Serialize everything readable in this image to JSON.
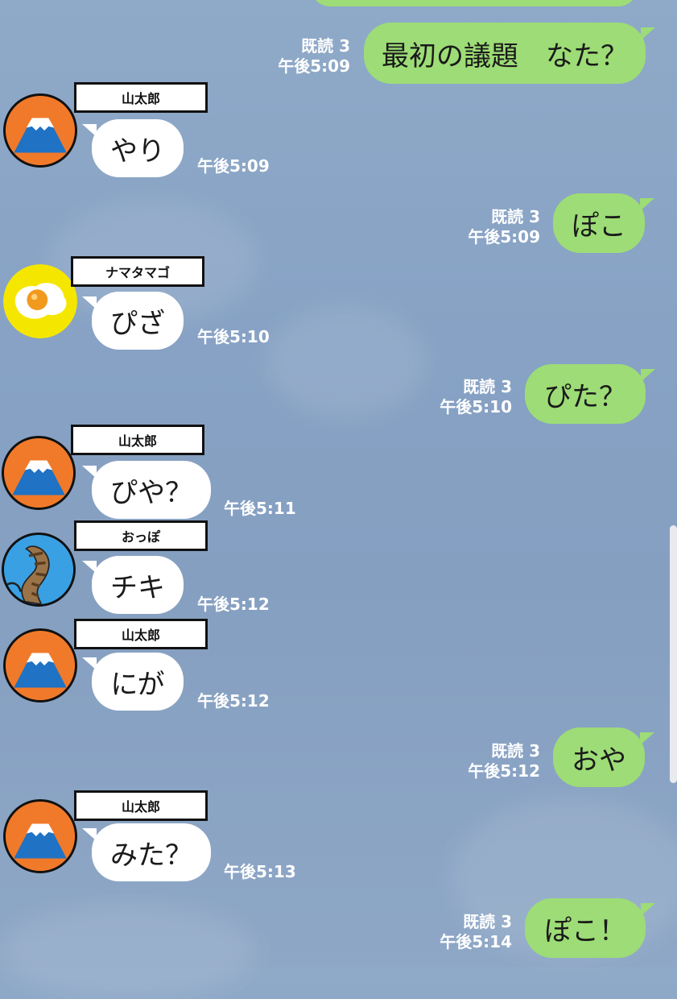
{
  "colors": {
    "my_bubble": "#9ddc76",
    "their_bubble": "#ffffff",
    "background": "#87a2c4"
  },
  "messages": [
    {
      "side": "me",
      "text": "",
      "read": "",
      "time": ""
    },
    {
      "side": "me",
      "text": "最初の議題　なた？",
      "read": "既読 3",
      "time": "午後5:09"
    },
    {
      "side": "them",
      "sender": "山太郎",
      "avatar": "mount-fuji-icon",
      "text": "やり",
      "time": "午後5:09"
    },
    {
      "side": "me",
      "text": "ぽこ",
      "read": "既読 3",
      "time": "午後5:09"
    },
    {
      "side": "them",
      "sender": "ナマタマゴ",
      "avatar": "fried-egg-icon",
      "text": "ぴざ",
      "time": "午後5:10"
    },
    {
      "side": "me",
      "text": "ぴた？",
      "read": "既読 3",
      "time": "午後5:10"
    },
    {
      "side": "them",
      "sender": "山太郎",
      "avatar": "mount-fuji-icon",
      "text": "ぴや？",
      "time": "午後5:11"
    },
    {
      "side": "them",
      "sender": "おっぽ",
      "avatar": "tail-icon",
      "text": "チキ",
      "time": "午後5:12"
    },
    {
      "side": "them",
      "sender": "山太郎",
      "avatar": "mount-fuji-icon",
      "text": "にが",
      "time": "午後5:12"
    },
    {
      "side": "me",
      "text": "おや",
      "read": "既読 3",
      "time": "午後5:12"
    },
    {
      "side": "them",
      "sender": "山太郎",
      "avatar": "mount-fuji-icon",
      "text": "みた？",
      "time": "午後5:13"
    },
    {
      "side": "me",
      "text": "ぽこ！",
      "read": "既読 3",
      "time": "午後5:14"
    }
  ]
}
